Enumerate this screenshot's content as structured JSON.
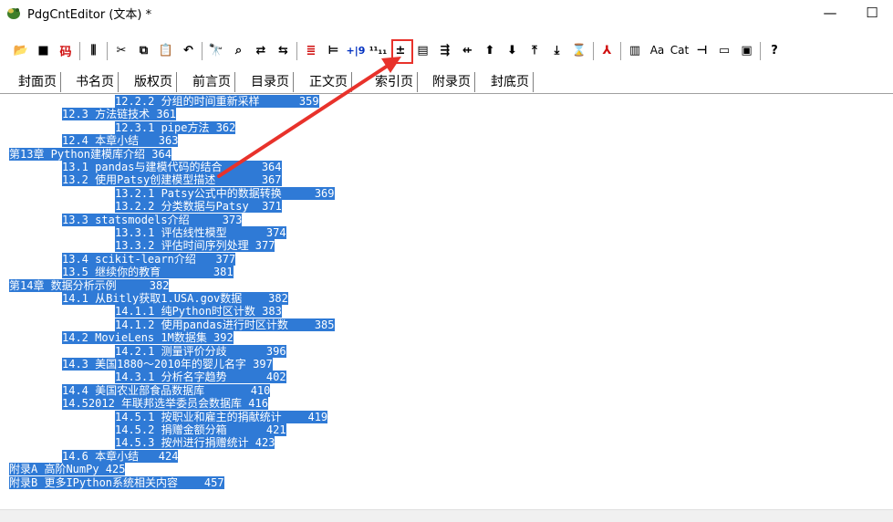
{
  "window": {
    "title": "PdgCntEditor (文本) *",
    "minimize_glyph": "—",
    "maximize_glyph": "☐"
  },
  "toolbar": {
    "items": [
      {
        "name": "open-icon",
        "glyph": "📂"
      },
      {
        "name": "save-icon",
        "glyph": "■"
      },
      {
        "name": "encoding-icon",
        "glyph": "码",
        "color": "#d01010"
      },
      {
        "name": "sep"
      },
      {
        "name": "page-icon",
        "glyph": "⫼"
      },
      {
        "name": "sep"
      },
      {
        "name": "cut-icon",
        "glyph": "✂"
      },
      {
        "name": "copy-icon",
        "glyph": "⧉"
      },
      {
        "name": "paste-icon",
        "glyph": "📋"
      },
      {
        "name": "undo-icon",
        "glyph": "↶"
      },
      {
        "name": "sep"
      },
      {
        "name": "find-icon",
        "glyph": "🔭"
      },
      {
        "name": "find-next-icon",
        "glyph": "⌕"
      },
      {
        "name": "replace-icon",
        "glyph": "⇄"
      },
      {
        "name": "replace-all-icon",
        "glyph": "⇆"
      },
      {
        "name": "sep"
      },
      {
        "name": "align-left-icon",
        "glyph": "≣",
        "color": "#d01010"
      },
      {
        "name": "align-tree-icon",
        "glyph": "⊨"
      },
      {
        "name": "page-offset-icon",
        "glyph": "+|9",
        "color": "#0030c0"
      },
      {
        "name": "number-icon",
        "glyph": "¹¹₁₁"
      },
      {
        "name": "plus-minus-icon",
        "glyph": "±"
      },
      {
        "name": "document-icon",
        "glyph": "▤"
      },
      {
        "name": "indent-increase-icon",
        "glyph": "⇶"
      },
      {
        "name": "indent-decrease-icon",
        "glyph": "⇷"
      },
      {
        "name": "move-up-icon",
        "glyph": "⬆"
      },
      {
        "name": "move-down-icon",
        "glyph": "⬇"
      },
      {
        "name": "merge-up-icon",
        "glyph": "⤒"
      },
      {
        "name": "merge-down-icon",
        "glyph": "⤓"
      },
      {
        "name": "expand-icon",
        "glyph": "⌛"
      },
      {
        "name": "sep"
      },
      {
        "name": "pdf-icon",
        "glyph": "⅄",
        "color": "#d01010"
      },
      {
        "name": "sep"
      },
      {
        "name": "columns-icon",
        "glyph": "▥"
      },
      {
        "name": "font-icon",
        "glyph": "Aa"
      },
      {
        "name": "cat-label",
        "glyph": "Cat"
      },
      {
        "name": "pin-icon",
        "glyph": "⊣"
      },
      {
        "name": "window-icon",
        "glyph": "▭"
      },
      {
        "name": "monitor-icon",
        "glyph": "▣"
      },
      {
        "name": "sep"
      },
      {
        "name": "help-icon",
        "glyph": "?"
      }
    ]
  },
  "tabs": [
    {
      "label": "封面页",
      "active": false
    },
    {
      "label": "书名页",
      "active": false
    },
    {
      "label": "版权页",
      "active": false
    },
    {
      "label": "前言页",
      "active": false
    },
    {
      "label": "目录页",
      "active": false
    },
    {
      "label": "正文页",
      "active": true
    },
    {
      "label": "索引页",
      "active": false
    },
    {
      "label": "附录页",
      "active": false
    },
    {
      "label": "封底页",
      "active": false
    }
  ],
  "lines": [
    {
      "text": "          12.2.2 分组的时间重新采样      359",
      "indent": 3
    },
    {
      "text": "12.3 方法链技术 361",
      "indent": 1
    },
    {
      "text": "12.3.1 pipe方法 362",
      "indent": 2
    },
    {
      "text": "12.4 本章小结   363",
      "indent": 1
    },
    {
      "text": "第13章 Python建模库介绍 364",
      "indent": 0
    },
    {
      "text": "13.1 pandas与建模代码的结合      364",
      "indent": 1
    },
    {
      "text": "13.2 使用Patsy创建模型描述       367",
      "indent": 1
    },
    {
      "text": "13.2.1 Patsy公式中的数据转换     369",
      "indent": 2
    },
    {
      "text": "13.2.2 分类数据与Patsy  371",
      "indent": 2
    },
    {
      "text": "13.3 statsmodels介绍     373",
      "indent": 1
    },
    {
      "text": "13.3.1 评估线性模型      374",
      "indent": 2
    },
    {
      "text": "13.3.2 评估时间序列处理 377",
      "indent": 2
    },
    {
      "text": "13.4 scikit-learn介绍   377",
      "indent": 1
    },
    {
      "text": "13.5 继续你的教育        381",
      "indent": 1
    },
    {
      "text": "第14章 数据分析示例     382",
      "indent": 0
    },
    {
      "text": "14.1 从Bitly获取1.USA.gov数据    382",
      "indent": 1
    },
    {
      "text": "14.1.1 纯Python时区计数 383",
      "indent": 2
    },
    {
      "text": "14.1.2 使用pandas进行时区计数    385",
      "indent": 2
    },
    {
      "text": "14.2 MovieLens 1M数据集 392",
      "indent": 1
    },
    {
      "text": "14.2.1 测量评价分歧      396",
      "indent": 2
    },
    {
      "text": "14.3 美国1880～2010年的婴儿名字 397",
      "indent": 1
    },
    {
      "text": "14.3.1 分析名字趋势      402",
      "indent": 2
    },
    {
      "text": "14.4 美国农业部食品数据库       410",
      "indent": 1
    },
    {
      "text": "14.52012 年联邦选举委员会数据库 416",
      "indent": 1
    },
    {
      "text": "14.5.1 按职业和雇主的捐献统计    419",
      "indent": 2
    },
    {
      "text": "14.5.2 捐赠金额分箱      421",
      "indent": 2
    },
    {
      "text": "14.5.3 按州进行捐赠统计 423",
      "indent": 2
    },
    {
      "text": "14.6 本章小结   424",
      "indent": 1
    },
    {
      "text": "附录A 高阶NumPy 425",
      "indent": 0
    },
    {
      "text": "附录B 更多IPython系统相关内容    457",
      "indent": 0
    }
  ],
  "colors": {
    "selection": "#2f7ad6",
    "annotation": "#e8322b"
  }
}
